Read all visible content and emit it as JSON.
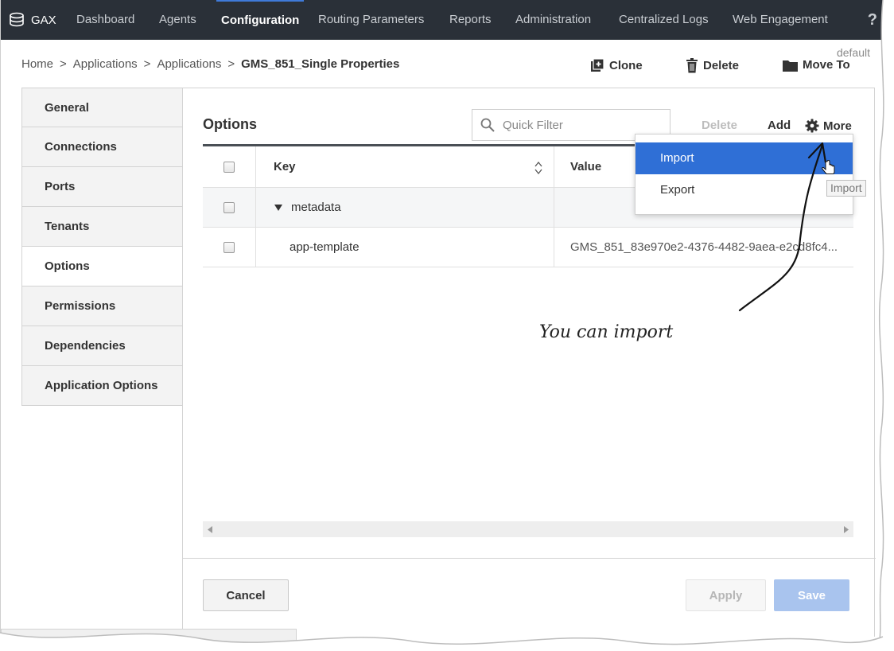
{
  "topnav": {
    "brand": "GAX",
    "items": [
      "Dashboard",
      "Agents",
      "Configuration",
      "Routing Parameters",
      "Reports",
      "Administration",
      "Centralized Logs",
      "Web Engagement"
    ],
    "help": "?"
  },
  "header": {
    "breadcrumb": [
      "Home",
      "Applications",
      "Applications",
      "GMS_851_Single Properties"
    ],
    "separator": ">",
    "tenant": "default",
    "actions": {
      "clone": "Clone",
      "delete": "Delete",
      "move_to": "Move To"
    }
  },
  "sidebar": {
    "items": [
      {
        "label": "General"
      },
      {
        "label": "Connections"
      },
      {
        "label": "Ports"
      },
      {
        "label": "Tenants"
      },
      {
        "label": "Options"
      },
      {
        "label": "Permissions"
      },
      {
        "label": "Dependencies"
      },
      {
        "label": "Application Options"
      }
    ],
    "active": "Options"
  },
  "options": {
    "title": "Options",
    "filter_placeholder": "Quick Filter",
    "toolbar": {
      "delete": "Delete",
      "add": "Add",
      "more": "More"
    },
    "columns": {
      "key": "Key",
      "value": "Value"
    },
    "rows": [
      {
        "key": "metadata",
        "value": "",
        "group": true
      },
      {
        "key": "app-template",
        "value": "GMS_851_83e970e2-4376-4482-9aea-e2cd8fc4..."
      }
    ]
  },
  "more_menu": {
    "items": [
      "Import",
      "Export"
    ],
    "highlighted": "Import",
    "tooltip": "Import"
  },
  "annotation": "You can import",
  "footer": {
    "cancel": "Cancel",
    "apply": "Apply",
    "save": "Save"
  },
  "colors": {
    "nav_bg": "#2a3038",
    "accent": "#2f6fd6",
    "save_disabled": "#a9c4ee"
  }
}
